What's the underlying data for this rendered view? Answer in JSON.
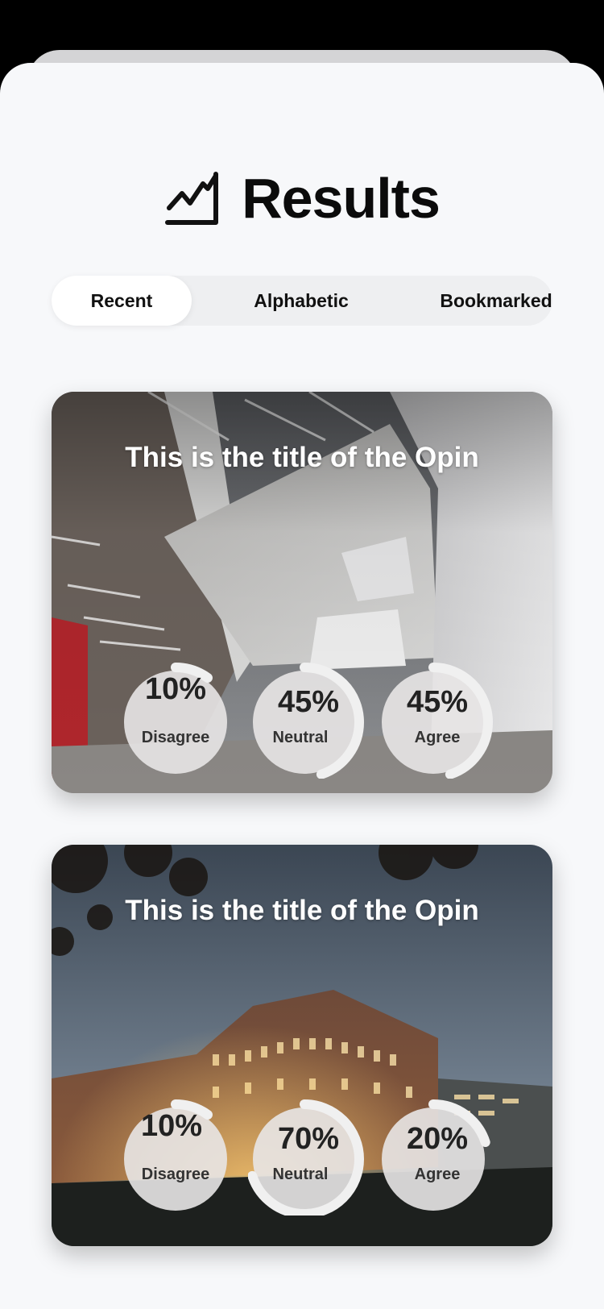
{
  "page": {
    "title": "Results"
  },
  "tabs": [
    {
      "label": "Recent",
      "active": true
    },
    {
      "label": "Alphabetic",
      "active": false
    },
    {
      "label": "Bookmarked",
      "active": false
    }
  ],
  "cards": [
    {
      "title": "This is the title of the Opin",
      "image": "modern-concrete-atrium-photo",
      "stats": [
        {
          "percent": "10%",
          "label": "Disagree",
          "value": 10
        },
        {
          "percent": "45%",
          "label": "Neutral",
          "value": 45
        },
        {
          "percent": "45%",
          "label": "Agree",
          "value": 45
        }
      ]
    },
    {
      "title": "This is the title of the Opin",
      "image": "brick-building-at-dusk-photo",
      "stats": [
        {
          "percent": "10%",
          "label": "Disagree",
          "value": 10
        },
        {
          "percent": "70%",
          "label": "Neutral",
          "value": 70
        },
        {
          "percent": "20%",
          "label": "Agree",
          "value": 20
        }
      ]
    }
  ],
  "icons": {
    "header": "chart-trend-icon"
  }
}
